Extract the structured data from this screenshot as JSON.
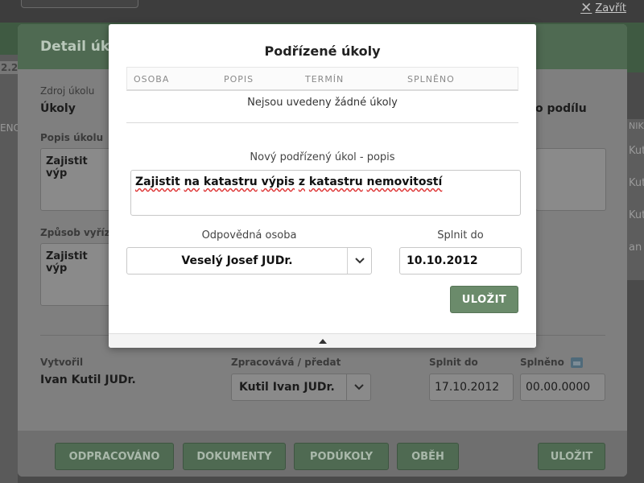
{
  "topbar": {
    "close_label": "Zavřít"
  },
  "background": {
    "left_fragments": [
      "2.2",
      "ENO"
    ],
    "right_fragments": [
      "NIK",
      "Kuti",
      "Kuti",
      "Kuti",
      "an"
    ]
  },
  "detail": {
    "title": "Detail úko",
    "zdroj_label": "Zdroj úkolu",
    "zdroj_value": "Úkoly",
    "podilu_label": "o podílu",
    "popis_label": "Popis úkolu",
    "popis_value": "Zajistit výp",
    "zpusob_label": "Způsob vyříze",
    "zpusob_value": "Zajistit výp",
    "vytvoril_label": "Vytvořil",
    "vytvoril_value": "Ivan Kutil JUDr.",
    "zpracovava_label": "Zpracovává / předat",
    "zpracovava_value": "Kutil Ivan JUDr.",
    "splnit_label": "Splnit do",
    "splnit_value": "17.10.2012",
    "splneno_label": "Splněno",
    "splneno_value": "00.00.0000",
    "buttons": {
      "odpracovano": "ODPRACOVÁNO",
      "dokumenty": "DOKUMENTY",
      "podukoly": "PODÚKOLY",
      "obeh": "OBĚH",
      "ulozit": "ULOŽIT"
    }
  },
  "modal": {
    "title": "Podřízené úkoly",
    "columns": [
      "OSOBA",
      "POPIS",
      "TERMÍN",
      "SPLNĚNO"
    ],
    "empty_message": "Nejsou uvedeny žádné úkoly",
    "new_task_label": "Nový podřízený úkol - popis",
    "new_task_words": [
      "Zajistit",
      "na",
      "katastru",
      "výpis",
      "z",
      "katastru",
      "nemovitostí"
    ],
    "person_label": "Odpovědná osoba",
    "person_value": "Veselý Josef JUDr.",
    "due_label": "Splnit do",
    "due_value": "10.10.2012",
    "save_label": "ULOŽIT"
  }
}
